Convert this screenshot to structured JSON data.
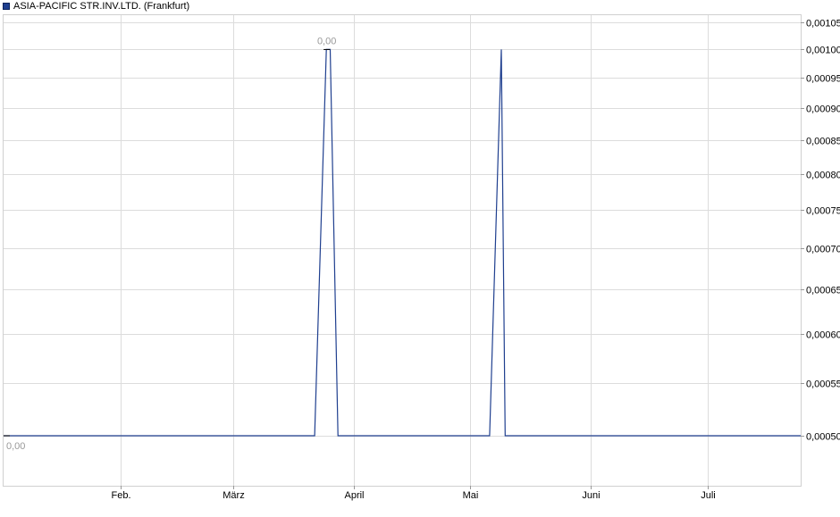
{
  "legend": {
    "label": "ASIA-PACIFIC STR.INV.LTD. (Frankfurt)",
    "color": "#1f3f8f"
  },
  "chart_data": {
    "type": "line",
    "series": [
      {
        "name": "ASIA-PACIFIC STR.INV.LTD. (Frankfurt)",
        "color": "#1f3f8f",
        "points": [
          {
            "x": "2024-01-02",
            "y": 0.0005
          },
          {
            "x": "2024-03-22",
            "y": 0.0005
          },
          {
            "x": "2024-03-25",
            "y": 0.001
          },
          {
            "x": "2024-03-26",
            "y": 0.001
          },
          {
            "x": "2024-03-28",
            "y": 0.0005
          },
          {
            "x": "2024-05-06",
            "y": 0.0005
          },
          {
            "x": "2024-05-09",
            "y": 0.001
          },
          {
            "x": "2024-05-10",
            "y": 0.0005
          },
          {
            "x": "2024-07-25",
            "y": 0.0005
          }
        ]
      }
    ],
    "x_range": [
      "2024-01-02",
      "2024-07-25"
    ],
    "ylim": [
      0.0005,
      0.00105
    ],
    "y_ticks": [
      "0,00105",
      "0,00100",
      "0,00095",
      "0,00090",
      "0,00085",
      "0,00080",
      "0,00075",
      "0,00070",
      "0,00065",
      "0,00060",
      "0,00055",
      "0,00050"
    ],
    "y_tick_values": [
      0.00105,
      0.001,
      0.00095,
      0.0009,
      0.00085,
      0.0008,
      0.00075,
      0.0007,
      0.00065,
      0.0006,
      0.00055,
      0.0005
    ],
    "x_ticks": [
      {
        "label": "Feb.",
        "date": "2024-02-01"
      },
      {
        "label": "März",
        "date": "2024-03-01"
      },
      {
        "label": "April",
        "date": "2024-04-01"
      },
      {
        "label": "Mai",
        "date": "2024-05-01"
      },
      {
        "label": "Juni",
        "date": "2024-06-01"
      },
      {
        "label": "Juli",
        "date": "2024-07-01"
      }
    ],
    "annotations": {
      "max_label": "0,00",
      "min_label": "0,00"
    },
    "grid": true,
    "y_axis_position": "right",
    "y_scale": "log"
  }
}
